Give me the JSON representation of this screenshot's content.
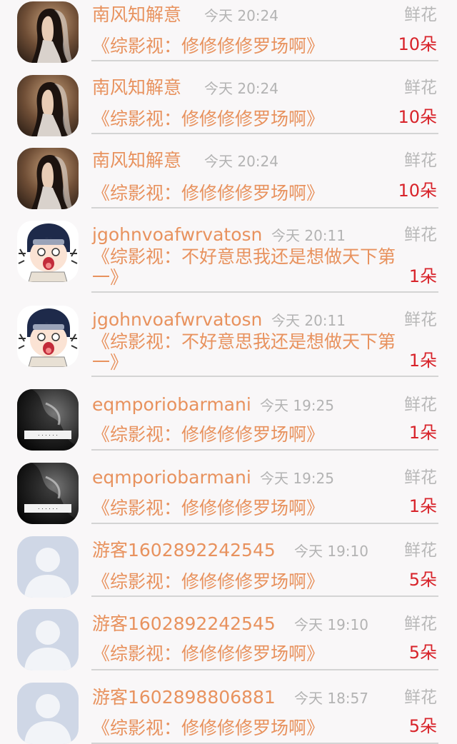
{
  "rows": [
    {
      "avatar": "girl-portrait",
      "name": "南风知解意",
      "time": "今天 20:24",
      "gift": "鲜花",
      "book": "《综影视：修修修修罗场啊》",
      "count": "10朵"
    },
    {
      "avatar": "girl-portrait",
      "name": "南风知解意",
      "time": "今天 20:24",
      "gift": "鲜花",
      "book": "《综影视：修修修修罗场啊》",
      "count": "10朵"
    },
    {
      "avatar": "girl-portrait",
      "name": "南风知解意",
      "time": "今天 20:24",
      "gift": "鲜花",
      "book": "《综影视：修修修修罗场啊》",
      "count": "10朵"
    },
    {
      "avatar": "anime-character",
      "name": "jgohnvoafwrvatosn",
      "time": "今天 20:11",
      "gift": "鲜花",
      "book": "《综影视：不好意思我还是想做天下第一》",
      "count": "1朵"
    },
    {
      "avatar": "anime-character",
      "name": "jgohnvoafwrvatosn",
      "time": "今天 20:11",
      "gift": "鲜花",
      "book": "《综影视：不好意思我还是想做天下第一》",
      "count": "1朵"
    },
    {
      "avatar": "smoke-photo",
      "name": "eqmporiobarmani",
      "time": "今天 19:25",
      "gift": "鲜花",
      "book": "《综影视：修修修修罗场啊》",
      "count": "1朵"
    },
    {
      "avatar": "smoke-photo",
      "name": "eqmporiobarmani",
      "time": "今天 19:25",
      "gift": "鲜花",
      "book": "《综影视：修修修修罗场啊》",
      "count": "1朵"
    },
    {
      "avatar": "default-user",
      "name": "游客1602892242545",
      "time": "今天 19:10",
      "gift": "鲜花",
      "book": "《综影视：修修修修罗场啊》",
      "count": "5朵"
    },
    {
      "avatar": "default-user",
      "name": "游客1602892242545",
      "time": "今天 19:10",
      "gift": "鲜花",
      "book": "《综影视：修修修修罗场啊》",
      "count": "5朵"
    },
    {
      "avatar": "default-user",
      "name": "游客1602898806881",
      "time": "今天 18:57",
      "gift": "鲜花",
      "book": "《综影视：修修修修罗场啊》",
      "count": "5朵"
    }
  ],
  "colors": {
    "name": "#e8925e",
    "count": "#d8232a",
    "muted": "#b3b3b3",
    "background": "#f9f7f8"
  }
}
